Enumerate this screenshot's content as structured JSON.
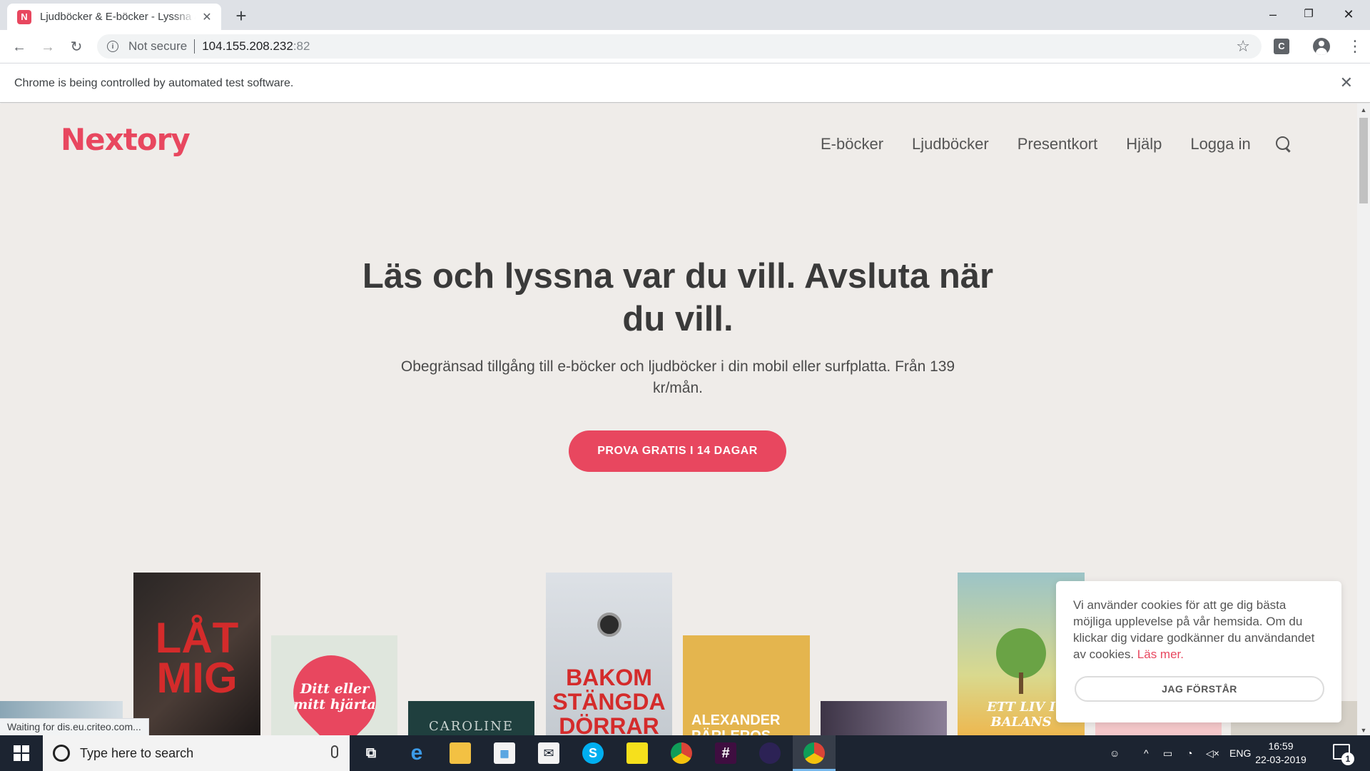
{
  "browser": {
    "tab_title": "Ljudböcker & E-böcker - Lyssna & läs",
    "tab_favicon_letter": "N",
    "new_tab_symbol": "+",
    "security_label": "Not secure",
    "url_host": "104.155.208.232",
    "url_port": ":82",
    "automation_notice": "Chrome is being controlled by automated test software.",
    "extension_letter": "C"
  },
  "site": {
    "logo": "Nextory",
    "brand_color": "#e8475f",
    "nav": [
      "E-böcker",
      "Ljudböcker",
      "Presentkort",
      "Hjälp",
      "Logga in"
    ],
    "hero_title": "Läs och lyssna var du vill. Avsluta när du vill.",
    "hero_subtitle": "Obegränsad tillgång till e-böcker och ljudböcker i din mobil eller surfplatta. Från 139 kr/mån.",
    "cta_label": "PROVA GRATIS I 14 DAGAR",
    "books": [
      {
        "title": "LÅT MIG"
      },
      {
        "title": "Ditt eller mitt hjärta"
      },
      {
        "title": "CAROLINE"
      },
      {
        "title": "BAKOM STÄNGDA DÖRRAR"
      },
      {
        "title": "ALEXANDER PÄRLEROS"
      },
      {
        "title": "ETT LIV I BALANS"
      }
    ],
    "status_text": "Waiting for dis.eu.criteo.com..."
  },
  "cookie_banner": {
    "text": "Vi använder cookies för att ge dig bästa möjliga upplevelse på vår hemsida. Om du klickar dig vidare godkänner du användandet av cookies.",
    "link": "Läs mer.",
    "button": "JAG FÖRSTÅR"
  },
  "taskbar": {
    "search_placeholder": "Type here to search",
    "language": "ENG",
    "time": "16:59",
    "date": "22-03-2019",
    "notification_count": "1"
  }
}
